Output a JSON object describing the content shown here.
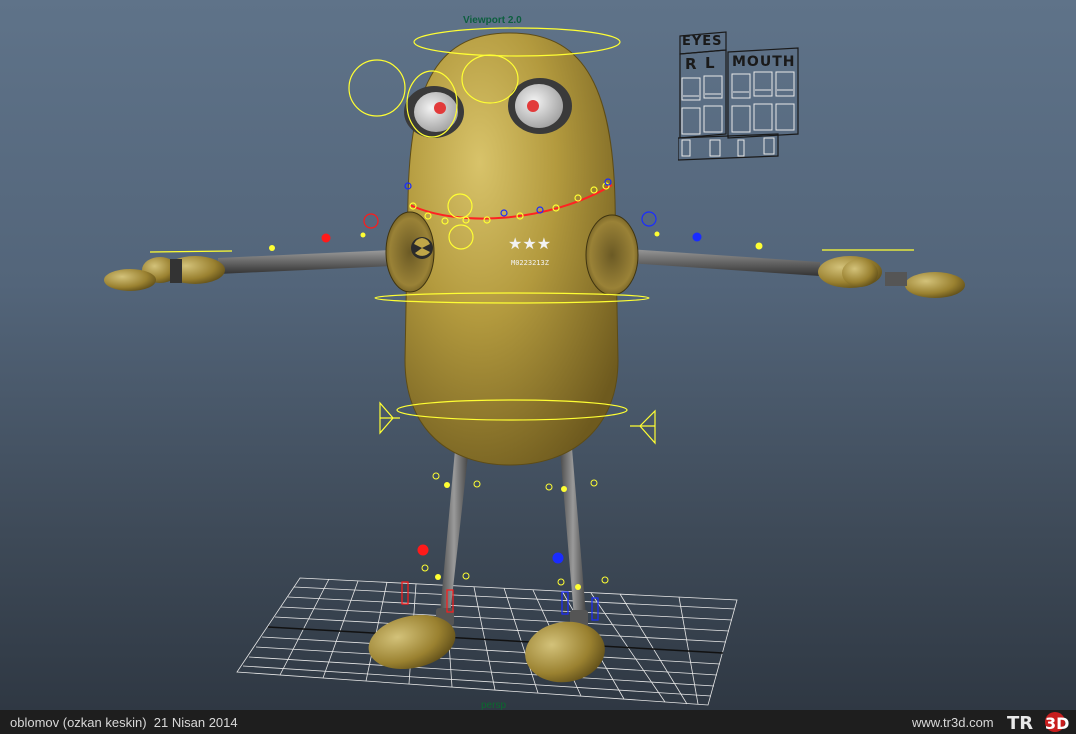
{
  "viewport": {
    "title": "Viewport 2.0",
    "camera_label": "persp"
  },
  "facial_panel": {
    "eyes_label": "EYES",
    "r_label": "R",
    "l_label": "L",
    "mouth_label": "MOUTH"
  },
  "character": {
    "chest_stars": "★★★",
    "chest_code": "M0223213Z"
  },
  "status_bar": {
    "credit": "oblomov (ozkan keskin)  21 Nisan 2014",
    "site": "www.tr3d.com",
    "logo_text_1": "TR",
    "logo_text_2": "3D"
  },
  "colors": {
    "rig_yellow": "#ffff33",
    "rig_red": "#ff1a1a",
    "rig_blue": "#1a2cff",
    "body_gold": "#b39a3e",
    "status_bg": "#1e1e1e"
  }
}
